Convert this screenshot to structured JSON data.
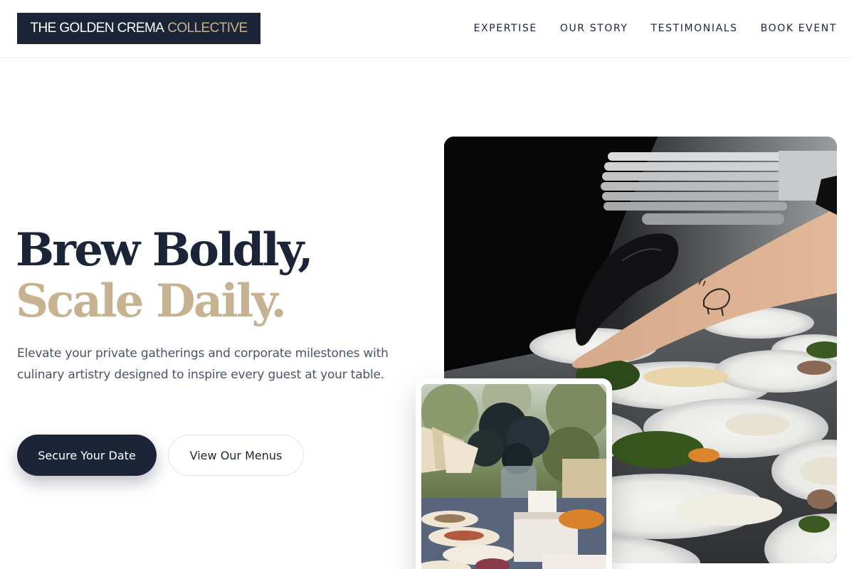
{
  "header": {
    "logo": {
      "primary": "THE GOLDEN CREMA",
      "accent": "COLLECTIVE"
    },
    "nav": [
      {
        "label": "EXPERTISE"
      },
      {
        "label": "OUR STORY"
      },
      {
        "label": "TESTIMONIALS"
      },
      {
        "label": "BOOK EVENT"
      }
    ]
  },
  "hero": {
    "title_line1": "Brew Boldly,",
    "title_line2": "Scale Daily.",
    "subtitle": "Elevate your private gatherings and corporate milestones with culinary artistry designed to inspire every guest at your table.",
    "primary_cta": "Secure Your Date",
    "secondary_cta": "View Our Menus"
  },
  "colors": {
    "navy": "#1c2538",
    "gold": "#c6b291",
    "body_text": "#4a5468"
  }
}
